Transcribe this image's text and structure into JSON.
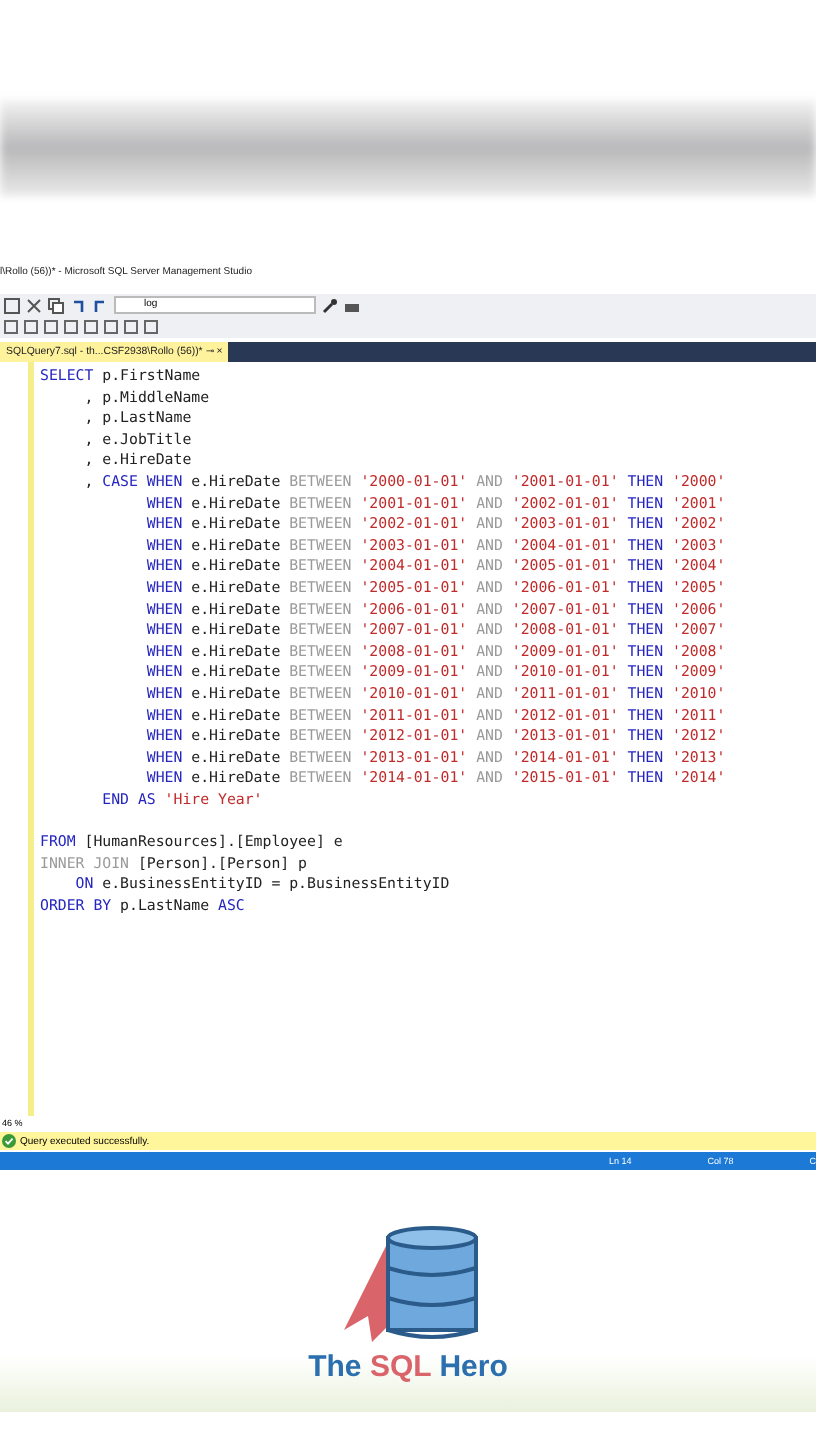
{
  "window": {
    "title": "l\\Rollo (56))* - Microsoft SQL Server Management Studio"
  },
  "toolbar": {
    "combo_value": "log"
  },
  "tab": {
    "label": "SQLQuery7.sql - th...CSF2938\\Rollo (56))*",
    "pin": "⊸",
    "close": "×",
    "selected": true
  },
  "editor": {
    "lines": [
      [
        {
          "kind": "kw",
          "text": "SELECT"
        },
        {
          "kind": "plain",
          "text": " p.FirstName"
        }
      ],
      [
        {
          "kind": "plain",
          "text": "     , p.MiddleName"
        }
      ],
      [
        {
          "kind": "plain",
          "text": "     , p.LastName"
        }
      ],
      [
        {
          "kind": "plain",
          "text": "     , e.JobTitle"
        }
      ],
      [
        {
          "kind": "plain",
          "text": "     , e.HireDate"
        }
      ],
      [
        {
          "kind": "plain",
          "text": "     , "
        },
        {
          "kind": "kw",
          "text": "CASE WHEN"
        },
        {
          "kind": "plain",
          "text": " e.HireDate "
        },
        {
          "kind": "gray",
          "text": "BETWEEN"
        },
        {
          "kind": "str",
          "text": " '2000-01-01'"
        },
        {
          "kind": "gray",
          "text": " AND"
        },
        {
          "kind": "str",
          "text": " '2001-01-01'"
        },
        {
          "kind": "kw",
          "text": " THEN"
        },
        {
          "kind": "str",
          "text": " '2000'"
        }
      ],
      [
        {
          "kind": "kw",
          "text": "            WHEN"
        },
        {
          "kind": "plain",
          "text": " e.HireDate "
        },
        {
          "kind": "gray",
          "text": "BETWEEN"
        },
        {
          "kind": "str",
          "text": " '2001-01-01'"
        },
        {
          "kind": "gray",
          "text": " AND"
        },
        {
          "kind": "str",
          "text": " '2002-01-01'"
        },
        {
          "kind": "kw",
          "text": " THEN"
        },
        {
          "kind": "str",
          "text": " '2001'"
        }
      ],
      [
        {
          "kind": "kw",
          "text": "            WHEN"
        },
        {
          "kind": "plain",
          "text": " e.HireDate "
        },
        {
          "kind": "gray",
          "text": "BETWEEN"
        },
        {
          "kind": "str",
          "text": " '2002-01-01'"
        },
        {
          "kind": "gray",
          "text": " AND"
        },
        {
          "kind": "str",
          "text": " '2003-01-01'"
        },
        {
          "kind": "kw",
          "text": " THEN"
        },
        {
          "kind": "str",
          "text": " '2002'"
        }
      ],
      [
        {
          "kind": "kw",
          "text": "            WHEN"
        },
        {
          "kind": "plain",
          "text": " e.HireDate "
        },
        {
          "kind": "gray",
          "text": "BETWEEN"
        },
        {
          "kind": "str",
          "text": " '2003-01-01'"
        },
        {
          "kind": "gray",
          "text": " AND"
        },
        {
          "kind": "str",
          "text": " '2004-01-01'"
        },
        {
          "kind": "kw",
          "text": " THEN"
        },
        {
          "kind": "str",
          "text": " '2003'"
        }
      ],
      [
        {
          "kind": "kw",
          "text": "            WHEN"
        },
        {
          "kind": "plain",
          "text": " e.HireDate "
        },
        {
          "kind": "gray",
          "text": "BETWEEN"
        },
        {
          "kind": "str",
          "text": " '2004-01-01'"
        },
        {
          "kind": "gray",
          "text": " AND"
        },
        {
          "kind": "str",
          "text": " '2005-01-01'"
        },
        {
          "kind": "kw",
          "text": " THEN"
        },
        {
          "kind": "str",
          "text": " '2004'"
        }
      ],
      [
        {
          "kind": "kw",
          "text": "            WHEN"
        },
        {
          "kind": "plain",
          "text": " e.HireDate "
        },
        {
          "kind": "gray",
          "text": "BETWEEN"
        },
        {
          "kind": "str",
          "text": " '2005-01-01'"
        },
        {
          "kind": "gray",
          "text": " AND"
        },
        {
          "kind": "str",
          "text": " '2006-01-01'"
        },
        {
          "kind": "kw",
          "text": " THEN"
        },
        {
          "kind": "str",
          "text": " '2005'"
        }
      ],
      [
        {
          "kind": "kw",
          "text": "            WHEN"
        },
        {
          "kind": "plain",
          "text": " e.HireDate "
        },
        {
          "kind": "gray",
          "text": "BETWEEN"
        },
        {
          "kind": "str",
          "text": " '2006-01-01'"
        },
        {
          "kind": "gray",
          "text": " AND"
        },
        {
          "kind": "str",
          "text": " '2007-01-01'"
        },
        {
          "kind": "kw",
          "text": " THEN"
        },
        {
          "kind": "str",
          "text": " '2006'"
        }
      ],
      [
        {
          "kind": "kw",
          "text": "            WHEN"
        },
        {
          "kind": "plain",
          "text": " e.HireDate "
        },
        {
          "kind": "gray",
          "text": "BETWEEN"
        },
        {
          "kind": "str",
          "text": " '2007-01-01'"
        },
        {
          "kind": "gray",
          "text": " AND"
        },
        {
          "kind": "str",
          "text": " '2008-01-01'"
        },
        {
          "kind": "kw",
          "text": " THEN"
        },
        {
          "kind": "str",
          "text": " '2007'"
        }
      ],
      [
        {
          "kind": "kw",
          "text": "            WHEN"
        },
        {
          "kind": "plain",
          "text": " e.HireDate "
        },
        {
          "kind": "gray",
          "text": "BETWEEN"
        },
        {
          "kind": "str",
          "text": " '2008-01-01'"
        },
        {
          "kind": "gray",
          "text": " AND"
        },
        {
          "kind": "str",
          "text": " '2009-01-01'"
        },
        {
          "kind": "kw",
          "text": " THEN"
        },
        {
          "kind": "str",
          "text": " '2008'"
        }
      ],
      [
        {
          "kind": "kw",
          "text": "            WHEN"
        },
        {
          "kind": "plain",
          "text": " e.HireDate "
        },
        {
          "kind": "gray",
          "text": "BETWEEN"
        },
        {
          "kind": "str",
          "text": " '2009-01-01'"
        },
        {
          "kind": "gray",
          "text": " AND"
        },
        {
          "kind": "str",
          "text": " '2010-01-01'"
        },
        {
          "kind": "kw",
          "text": " THEN"
        },
        {
          "kind": "str",
          "text": " '2009'"
        }
      ],
      [
        {
          "kind": "kw",
          "text": "            WHEN"
        },
        {
          "kind": "plain",
          "text": " e.HireDate "
        },
        {
          "kind": "gray",
          "text": "BETWEEN"
        },
        {
          "kind": "str",
          "text": " '2010-01-01'"
        },
        {
          "kind": "gray",
          "text": " AND"
        },
        {
          "kind": "str",
          "text": " '2011-01-01'"
        },
        {
          "kind": "kw",
          "text": " THEN"
        },
        {
          "kind": "str",
          "text": " '2010'"
        }
      ],
      [
        {
          "kind": "kw",
          "text": "            WHEN"
        },
        {
          "kind": "plain",
          "text": " e.HireDate "
        },
        {
          "kind": "gray",
          "text": "BETWEEN"
        },
        {
          "kind": "str",
          "text": " '2011-01-01'"
        },
        {
          "kind": "gray",
          "text": " AND"
        },
        {
          "kind": "str",
          "text": " '2012-01-01'"
        },
        {
          "kind": "kw",
          "text": " THEN"
        },
        {
          "kind": "str",
          "text": " '2011'"
        }
      ],
      [
        {
          "kind": "kw",
          "text": "            WHEN"
        },
        {
          "kind": "plain",
          "text": " e.HireDate "
        },
        {
          "kind": "gray",
          "text": "BETWEEN"
        },
        {
          "kind": "str",
          "text": " '2012-01-01'"
        },
        {
          "kind": "gray",
          "text": " AND"
        },
        {
          "kind": "str",
          "text": " '2013-01-01'"
        },
        {
          "kind": "kw",
          "text": " THEN"
        },
        {
          "kind": "str",
          "text": " '2012'"
        }
      ],
      [
        {
          "kind": "kw",
          "text": "            WHEN"
        },
        {
          "kind": "plain",
          "text": " e.HireDate "
        },
        {
          "kind": "gray",
          "text": "BETWEEN"
        },
        {
          "kind": "str",
          "text": " '2013-01-01'"
        },
        {
          "kind": "gray",
          "text": " AND"
        },
        {
          "kind": "str",
          "text": " '2014-01-01'"
        },
        {
          "kind": "kw",
          "text": " THEN"
        },
        {
          "kind": "str",
          "text": " '2013'"
        }
      ],
      [
        {
          "kind": "kw",
          "text": "            WHEN"
        },
        {
          "kind": "plain",
          "text": " e.HireDate "
        },
        {
          "kind": "gray",
          "text": "BETWEEN"
        },
        {
          "kind": "str",
          "text": " '2014-01-01'"
        },
        {
          "kind": "gray",
          "text": " AND"
        },
        {
          "kind": "str",
          "text": " '2015-01-01'"
        },
        {
          "kind": "kw",
          "text": " THEN"
        },
        {
          "kind": "str",
          "text": " '2014'"
        }
      ],
      [
        {
          "kind": "kw",
          "text": "       END AS"
        },
        {
          "kind": "str",
          "text": " 'Hire Year'"
        }
      ],
      {
        "kind": "blank"
      },
      [
        {
          "kind": "kw",
          "text": "FROM"
        },
        {
          "kind": "plain",
          "text": " [HumanResources].[Employee] e"
        }
      ],
      [
        {
          "kind": "gray",
          "text": "INNER JOIN"
        },
        {
          "kind": "plain",
          "text": " [Person].[Person] p"
        }
      ],
      [
        {
          "kind": "kw",
          "text": "    ON"
        },
        {
          "kind": "plain",
          "text": " e.BusinessEntityID = p.BusinessEntityID"
        }
      ],
      [
        {
          "kind": "kw",
          "text": "ORDER BY"
        },
        {
          "kind": "plain",
          "text": " p.LastName "
        },
        {
          "kind": "kw",
          "text": "ASC"
        }
      ]
    ]
  },
  "zoom": "46 %",
  "query_status": "Query executed successfully.",
  "status_bar": {
    "line": "Ln 14",
    "column": "Col 78",
    "column_3": "C"
  },
  "logo": {
    "words": [
      {
        "text": "The",
        "accent": false
      },
      {
        "text": "SQL",
        "accent": true
      },
      {
        "text": "Hero",
        "accent": false
      }
    ]
  }
}
